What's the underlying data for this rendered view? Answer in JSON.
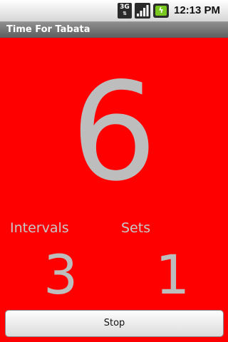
{
  "status_bar": {
    "network": "3G",
    "network_icon": "3g-data-icon",
    "signal_icon": "signal-strength-icon",
    "battery_icon": "battery-charging-icon",
    "time": "12:13 PM"
  },
  "app": {
    "title": "Time For Tabata"
  },
  "timer": {
    "countdown": "6",
    "intervals_label": "Intervals",
    "intervals_value": "3",
    "sets_label": "Sets",
    "sets_value": "1",
    "background_color": "#ff0000"
  },
  "actions": {
    "stop_label": "Stop"
  }
}
